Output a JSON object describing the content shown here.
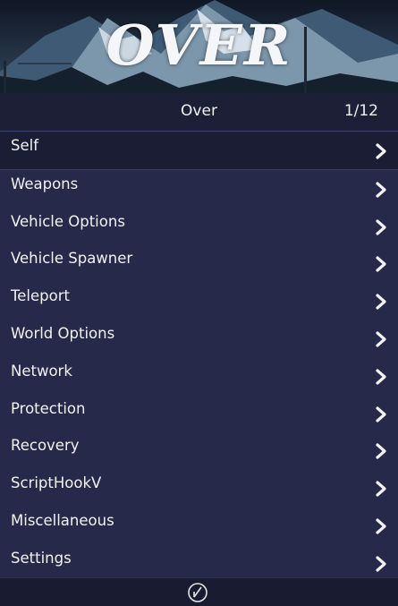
{
  "header": {
    "logo_text": "OVER",
    "title": "Over",
    "counter": "1/12"
  },
  "items": [
    {
      "label": "Self",
      "selected": true,
      "icon": "chevron-right-icon"
    },
    {
      "label": "Weapons",
      "icon": "chevron-right-icon"
    },
    {
      "label": "Vehicle Options",
      "icon": "chevron-right-icon"
    },
    {
      "label": "Vehicle Spawner",
      "icon": "chevron-right-icon"
    },
    {
      "label": "Teleport",
      "icon": "chevron-right-icon"
    },
    {
      "label": "World Options",
      "icon": "chevron-right-icon"
    },
    {
      "label": "Network",
      "icon": "chevron-right-icon"
    },
    {
      "label": "Protection",
      "icon": "chevron-right-icon"
    },
    {
      "label": "Recovery",
      "icon": "chevron-right-icon"
    },
    {
      "label": "ScriptHookV",
      "icon": "chevron-right-icon"
    },
    {
      "label": "Miscellaneous",
      "icon": "chevron-right-icon"
    },
    {
      "label": "Settings",
      "icon": "chevron-right-icon"
    }
  ],
  "footer": {
    "icon": "compass-icon"
  },
  "colors": {
    "background": "#262949",
    "header_bg": "#1d1f36",
    "selected_bg": "#1b1d34",
    "text": "#f2f2f2"
  }
}
